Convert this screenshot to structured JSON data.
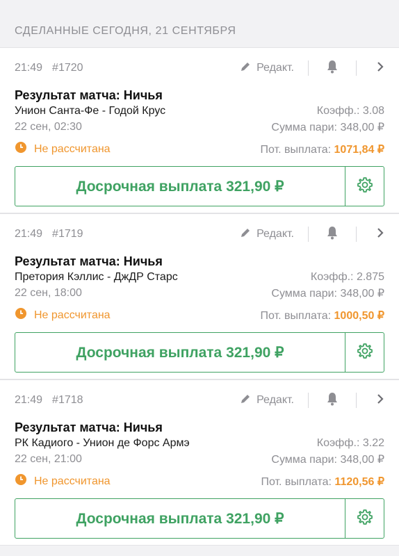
{
  "section": {
    "title": "СДЕЛАННЫЕ СЕГОДНЯ, 21 СЕНТЯБРЯ"
  },
  "labels": {
    "edit": "Редакт.",
    "odds_label": "Коэфф.:",
    "stake_label": "Сумма пари:",
    "potential_label": "Пот. выплата:",
    "cashout": "Досрочная выплата 321,90 ₽"
  },
  "bets": [
    {
      "time": "21:49",
      "id": "#1720",
      "market": "Результат матча: Ничья",
      "teams": "Унион Санта-Фе - Годой Крус",
      "odds": "3.08",
      "event_date": "22 сен, 02:30",
      "stake": "348,00 ₽",
      "status": "Не рассчитана",
      "potential": "1071,84 ₽"
    },
    {
      "time": "21:49",
      "id": "#1719",
      "market": "Результат матча: Ничья",
      "teams": "Претория Кэллис - ДжДР Старс",
      "odds": "2.875",
      "event_date": "22 сен, 18:00",
      "stake": "348,00 ₽",
      "status": "Не рассчитана",
      "potential": "1000,50 ₽"
    },
    {
      "time": "21:49",
      "id": "#1718",
      "market": "Результат матча: Ничья",
      "teams": "РК Кадиого - Унион де Форс Армэ",
      "odds": "3.22",
      "event_date": "22 сен, 21:00",
      "stake": "348,00 ₽",
      "status": "Не рассчитана",
      "potential": "1120,56 ₽"
    }
  ],
  "colors": {
    "accent_green": "#3fa262",
    "warning_orange": "#f0962e",
    "muted_gray": "#8e8e93"
  },
  "icons": [
    "pencil-icon",
    "bell-icon",
    "chevron-right-icon",
    "clock-icon",
    "gear-icon"
  ]
}
